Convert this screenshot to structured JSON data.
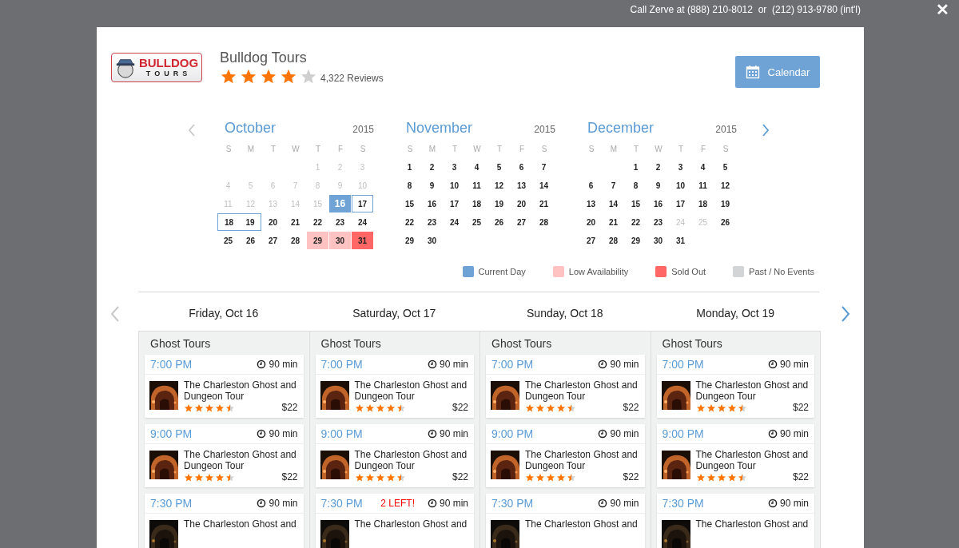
{
  "topbar": {
    "phone": "Call Zerve at (888) 210-8012  or  (212) 913-9780 (int'l)",
    "close": "✕"
  },
  "vendor": {
    "logo_top": "BULLDOG",
    "logo_bottom": "TOURS",
    "name": "Bulldog Tours",
    "stars": 4,
    "reviews": "4,322 Reviews"
  },
  "calendar_button": "Calendar",
  "months": [
    {
      "name": "October",
      "year": "2015",
      "weekdays": [
        "S",
        "M",
        "T",
        "W",
        "T",
        "F",
        "S"
      ],
      "weeks": [
        [
          {
            "day": "1",
            "kind": "past",
            "selected": false
          },
          {
            "day": "2",
            "kind": "past",
            "selected": false
          },
          {
            "day": "3",
            "kind": "past",
            "selected": false
          }
        ],
        [
          {
            "day": "4",
            "kind": "past",
            "selected": false
          },
          {
            "day": "5",
            "kind": "past",
            "selected": false
          },
          {
            "day": "6",
            "kind": "past",
            "selected": false
          },
          {
            "day": "7",
            "kind": "past",
            "selected": false
          },
          {
            "day": "8",
            "kind": "past",
            "selected": false
          },
          {
            "day": "9",
            "kind": "past",
            "selected": false
          },
          {
            "day": "10",
            "kind": "past",
            "selected": false
          }
        ],
        [
          {
            "day": "11",
            "kind": "past",
            "selected": false
          },
          {
            "day": "12",
            "kind": "past",
            "selected": false
          },
          {
            "day": "13",
            "kind": "past",
            "selected": false
          },
          {
            "day": "14",
            "kind": "past",
            "selected": false
          },
          {
            "day": "15",
            "kind": "past",
            "selected": false
          },
          {
            "day": "16",
            "kind": "current",
            "selected": false
          },
          {
            "day": "17",
            "kind": "open",
            "selected": true
          }
        ],
        [
          {
            "day": "18",
            "kind": "open",
            "selected": true
          },
          {
            "day": "19",
            "kind": "open",
            "selected": true
          },
          {
            "day": "20",
            "kind": "open",
            "selected": false
          },
          {
            "day": "21",
            "kind": "open",
            "selected": false
          },
          {
            "day": "22",
            "kind": "open",
            "selected": false
          },
          {
            "day": "23",
            "kind": "open",
            "selected": false
          },
          {
            "day": "24",
            "kind": "open",
            "selected": false
          }
        ],
        [
          {
            "day": "25",
            "kind": "open",
            "selected": false
          },
          {
            "day": "26",
            "kind": "open",
            "selected": false
          },
          {
            "day": "27",
            "kind": "open",
            "selected": false
          },
          {
            "day": "28",
            "kind": "open",
            "selected": false
          },
          {
            "day": "29",
            "kind": "low",
            "selected": false
          },
          {
            "day": "30",
            "kind": "low",
            "selected": false
          },
          {
            "day": "31",
            "kind": "sold",
            "selected": false
          }
        ]
      ]
    },
    {
      "name": "November",
      "year": "2015",
      "weekdays": [
        "S",
        "M",
        "T",
        "W",
        "T",
        "F",
        "S"
      ],
      "weeks": [
        [
          {
            "day": "1",
            "kind": "open",
            "selected": false
          },
          {
            "day": "2",
            "kind": "open",
            "selected": false
          },
          {
            "day": "3",
            "kind": "open",
            "selected": false
          },
          {
            "day": "4",
            "kind": "open",
            "selected": false
          },
          {
            "day": "5",
            "kind": "open",
            "selected": false
          },
          {
            "day": "6",
            "kind": "open",
            "selected": false
          },
          {
            "day": "7",
            "kind": "open",
            "selected": false
          }
        ],
        [
          {
            "day": "8",
            "kind": "open",
            "selected": false
          },
          {
            "day": "9",
            "kind": "open",
            "selected": false
          },
          {
            "day": "10",
            "kind": "open",
            "selected": false
          },
          {
            "day": "11",
            "kind": "open",
            "selected": false
          },
          {
            "day": "12",
            "kind": "open",
            "selected": false
          },
          {
            "day": "13",
            "kind": "open",
            "selected": false
          },
          {
            "day": "14",
            "kind": "open",
            "selected": false
          }
        ],
        [
          {
            "day": "15",
            "kind": "open",
            "selected": false
          },
          {
            "day": "16",
            "kind": "open",
            "selected": false
          },
          {
            "day": "17",
            "kind": "open",
            "selected": false
          },
          {
            "day": "18",
            "kind": "open",
            "selected": false
          },
          {
            "day": "19",
            "kind": "open",
            "selected": false
          },
          {
            "day": "20",
            "kind": "open",
            "selected": false
          },
          {
            "day": "21",
            "kind": "open",
            "selected": false
          }
        ],
        [
          {
            "day": "22",
            "kind": "open",
            "selected": false
          },
          {
            "day": "23",
            "kind": "open",
            "selected": false
          },
          {
            "day": "24",
            "kind": "open",
            "selected": false
          },
          {
            "day": "25",
            "kind": "open",
            "selected": false
          },
          {
            "day": "26",
            "kind": "open",
            "selected": false
          },
          {
            "day": "27",
            "kind": "open",
            "selected": false
          },
          {
            "day": "28",
            "kind": "open",
            "selected": false
          }
        ],
        [
          {
            "day": "29",
            "kind": "open",
            "selected": false
          },
          {
            "day": "30",
            "kind": "open",
            "selected": false
          }
        ]
      ]
    },
    {
      "name": "December",
      "year": "2015",
      "weekdays": [
        "S",
        "M",
        "T",
        "W",
        "T",
        "F",
        "S"
      ],
      "weeks": [
        [
          {
            "day": "1",
            "kind": "open",
            "selected": false
          },
          {
            "day": "2",
            "kind": "open",
            "selected": false
          },
          {
            "day": "3",
            "kind": "open",
            "selected": false
          },
          {
            "day": "4",
            "kind": "open",
            "selected": false
          },
          {
            "day": "5",
            "kind": "open",
            "selected": false
          }
        ],
        [
          {
            "day": "6",
            "kind": "open",
            "selected": false
          },
          {
            "day": "7",
            "kind": "open",
            "selected": false
          },
          {
            "day": "8",
            "kind": "open",
            "selected": false
          },
          {
            "day": "9",
            "kind": "open",
            "selected": false
          },
          {
            "day": "10",
            "kind": "open",
            "selected": false
          },
          {
            "day": "11",
            "kind": "open",
            "selected": false
          },
          {
            "day": "12",
            "kind": "open",
            "selected": false
          }
        ],
        [
          {
            "day": "13",
            "kind": "open",
            "selected": false
          },
          {
            "day": "14",
            "kind": "open",
            "selected": false
          },
          {
            "day": "15",
            "kind": "open",
            "selected": false
          },
          {
            "day": "16",
            "kind": "open",
            "selected": false
          },
          {
            "day": "17",
            "kind": "open",
            "selected": false
          },
          {
            "day": "18",
            "kind": "open",
            "selected": false
          },
          {
            "day": "19",
            "kind": "open",
            "selected": false
          }
        ],
        [
          {
            "day": "20",
            "kind": "open",
            "selected": false
          },
          {
            "day": "21",
            "kind": "open",
            "selected": false
          },
          {
            "day": "22",
            "kind": "open",
            "selected": false
          },
          {
            "day": "23",
            "kind": "open",
            "selected": false
          },
          {
            "day": "24",
            "kind": "past",
            "selected": false
          },
          {
            "day": "25",
            "kind": "past",
            "selected": false
          },
          {
            "day": "26",
            "kind": "open",
            "selected": false
          }
        ],
        [
          {
            "day": "27",
            "kind": "open",
            "selected": false
          },
          {
            "day": "28",
            "kind": "open",
            "selected": false
          },
          {
            "day": "29",
            "kind": "open",
            "selected": false
          },
          {
            "day": "30",
            "kind": "open",
            "selected": false
          },
          {
            "day": "31",
            "kind": "open",
            "selected": false
          }
        ]
      ]
    }
  ],
  "legend": [
    {
      "label": "Current Day",
      "color": "#6fa3d6"
    },
    {
      "label": "Low Availability",
      "color": "#ffc2c2"
    },
    {
      "label": "Sold Out",
      "color": "#ff6666"
    },
    {
      "label": "Past / No Events",
      "color": "#d3d4d6"
    }
  ],
  "days": [
    {
      "date": "Friday, Oct 16",
      "category": "Ghost Tours",
      "slots": [
        {
          "time": "7:00 PM",
          "duration": "90 min",
          "title": "The Charleston Ghost and Dungeon Tour",
          "stars": 4.5,
          "price": "$22"
        },
        {
          "time": "9:00 PM",
          "duration": "90 min",
          "title": "The Charleston Ghost and Dungeon Tour",
          "stars": 4.5,
          "price": "$22"
        },
        {
          "time": "7:30 PM",
          "duration": "90 min",
          "title": "The Charleston Ghost and"
        }
      ]
    },
    {
      "date": "Saturday, Oct 17",
      "category": "Ghost Tours",
      "slots": [
        {
          "time": "7:00 PM",
          "duration": "90 min",
          "title": "The Charleston Ghost and Dungeon Tour",
          "stars": 4.5,
          "price": "$22"
        },
        {
          "time": "9:00 PM",
          "duration": "90 min",
          "title": "The Charleston Ghost and Dungeon Tour",
          "stars": 4.5,
          "price": "$22"
        },
        {
          "time": "7:30 PM",
          "alert": "2 LEFT!",
          "duration": "90 min",
          "title": "The Charleston Ghost and"
        }
      ]
    },
    {
      "date": "Sunday, Oct 18",
      "category": "Ghost Tours",
      "slots": [
        {
          "time": "7:00 PM",
          "duration": "90 min",
          "title": "The Charleston Ghost and Dungeon Tour",
          "stars": 4.5,
          "price": "$22"
        },
        {
          "time": "9:00 PM",
          "duration": "90 min",
          "title": "The Charleston Ghost and Dungeon Tour",
          "stars": 4.5,
          "price": "$22"
        },
        {
          "time": "7:30 PM",
          "duration": "90 min",
          "title": "The Charleston Ghost and"
        }
      ]
    },
    {
      "date": "Monday, Oct 19",
      "category": "Ghost Tours",
      "slots": [
        {
          "time": "7:00 PM",
          "duration": "90 min",
          "title": "The Charleston Ghost and Dungeon Tour",
          "stars": 4.5,
          "price": "$22"
        },
        {
          "time": "9:00 PM",
          "duration": "90 min",
          "title": "The Charleston Ghost and Dungeon Tour",
          "stars": 4.5,
          "price": "$22"
        },
        {
          "time": "7:30 PM",
          "duration": "90 min",
          "title": "The Charleston Ghost and"
        }
      ]
    }
  ]
}
